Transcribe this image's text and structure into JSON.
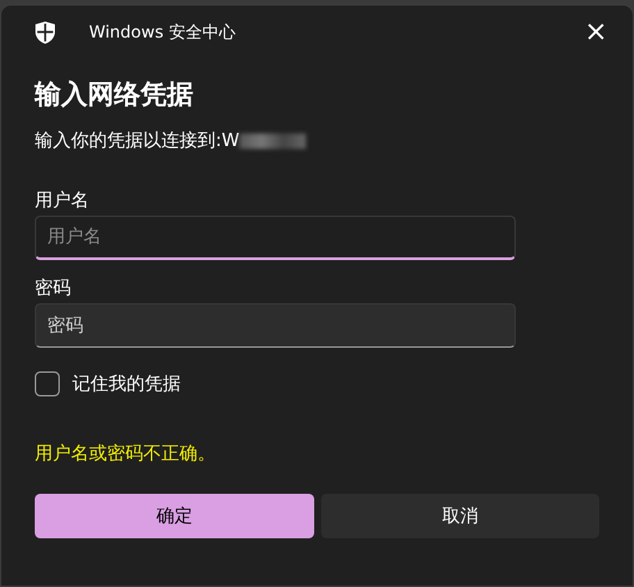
{
  "window": {
    "title": "Windows 安全中心",
    "close": "×"
  },
  "heading": "输入网络凭据",
  "subtitle": "输入你的凭据以连接到:W",
  "fields": [
    {
      "label": "用户名",
      "placeholder": "用户名",
      "focused": true
    },
    {
      "label": "密码",
      "placeholder": "密码",
      "focused": false
    }
  ],
  "remember": {
    "label": "记住我的凭据",
    "checked": false
  },
  "error": "用户名或密码不正确。",
  "buttons": [
    {
      "label": "确定",
      "kind": "primary"
    },
    {
      "label": "取消",
      "kind": "secondary"
    }
  ]
}
